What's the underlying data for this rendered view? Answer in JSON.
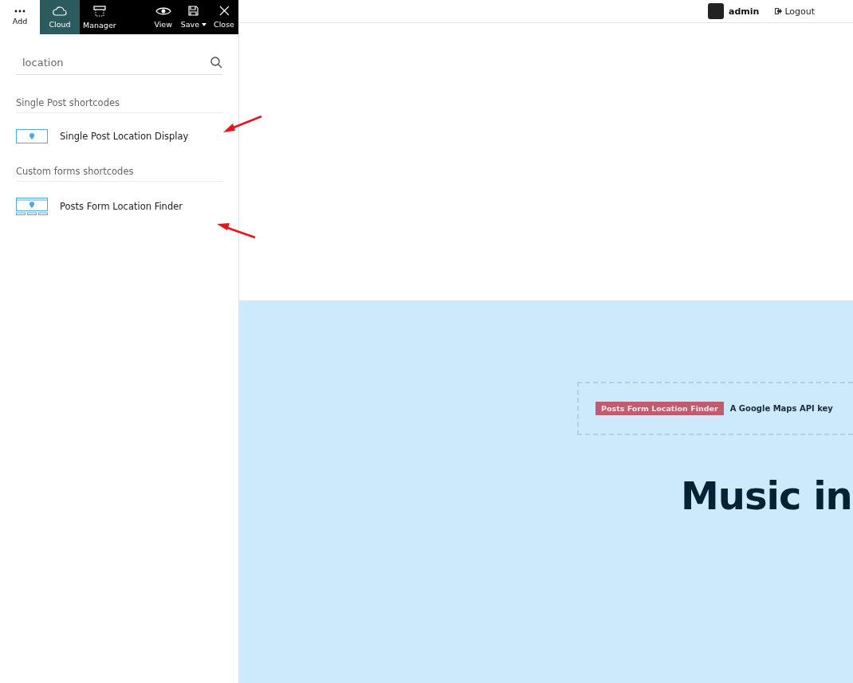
{
  "toolbar": {
    "tools": [
      {
        "kind": "add",
        "label": "Add",
        "selected": false
      },
      {
        "kind": "tool",
        "label": "Cloud",
        "selected": true
      },
      {
        "kind": "tool",
        "label": "Manager",
        "selected": false
      },
      {
        "kind": "spacer"
      },
      {
        "kind": "tool",
        "label": "View",
        "selected": false
      },
      {
        "kind": "menu",
        "label": "Save",
        "selected": false
      },
      {
        "kind": "tool",
        "label": "Close",
        "selected": false
      }
    ]
  },
  "search": {
    "value": "location"
  },
  "groups": [
    {
      "title": "Single Post shortcodes",
      "items": [
        {
          "label": "Single Post Location Display",
          "kind": "single"
        }
      ]
    },
    {
      "title": "Custom forms shortcodes",
      "items": [
        {
          "label": "Posts Form Location Finder",
          "kind": "form"
        }
      ]
    }
  ],
  "topbar": {
    "user": "admin",
    "logout": "Logout"
  },
  "canvas": {
    "tag": "Posts Form Location Finder",
    "notice": "A Google Maps API key",
    "heading": "Music in"
  }
}
